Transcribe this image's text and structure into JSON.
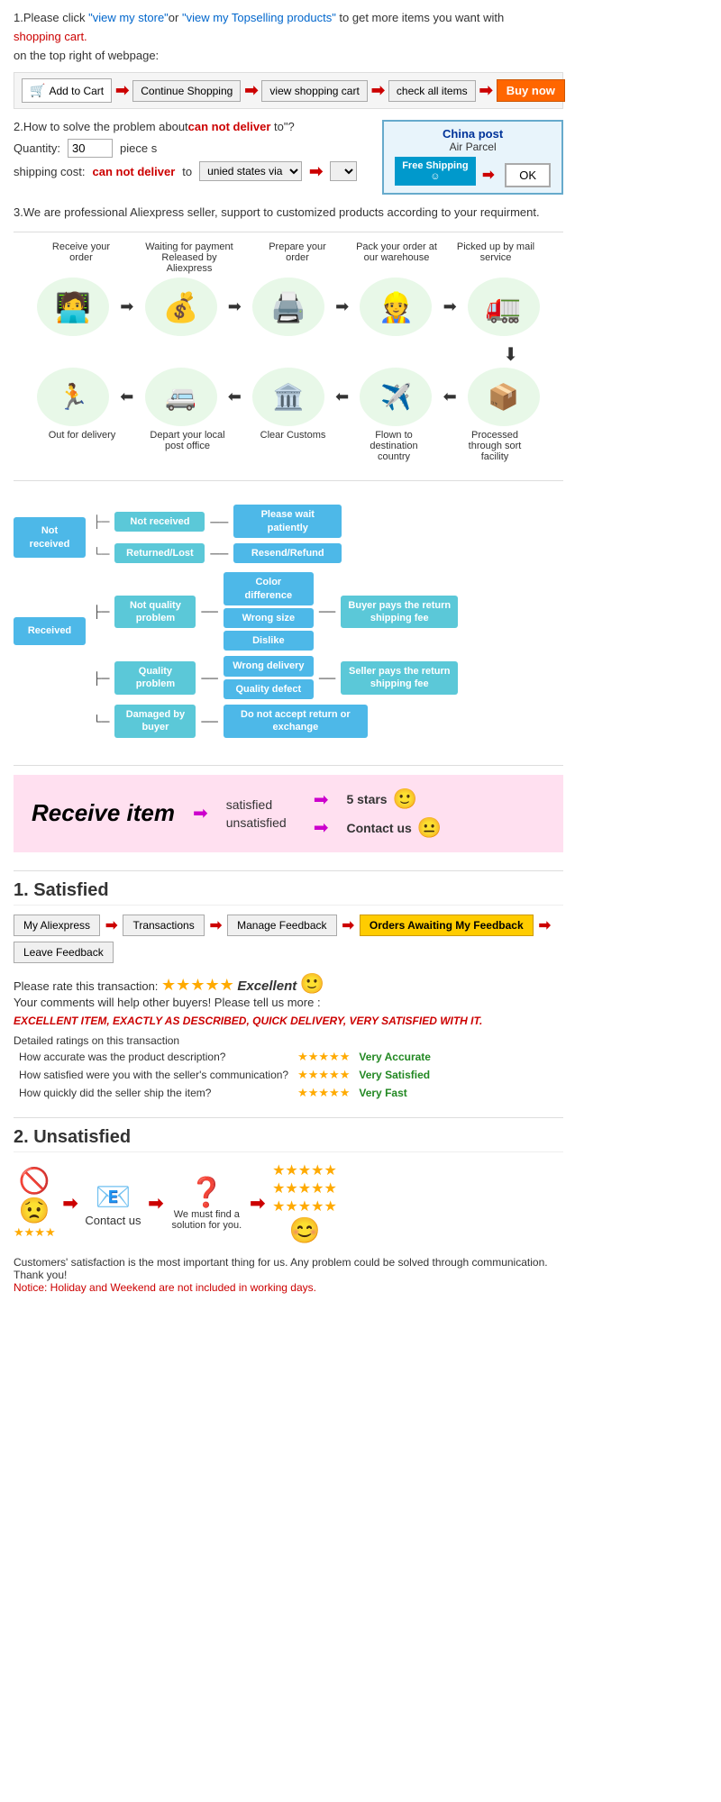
{
  "section1": {
    "text1": "1.Please click ",
    "link1": "\"view my store\"",
    "text2": "or ",
    "link2": "\"view my Topselling products\"",
    "text3": " to get more items you want with",
    "shopping_cart": "shopping cart.",
    "text4": "on the top right of webpage:",
    "buttons": {
      "add_cart": "Add to Cart",
      "continue": "Continue Shopping",
      "view_cart": "view shopping cart",
      "check_all": "check all items",
      "buy_now": "Buy now"
    }
  },
  "section2": {
    "title": "2.How to solve the problem about",
    "cant_deliver": "can not deliver",
    "title2": " to\"?",
    "qty_label": "Quantity:",
    "qty_value": "30",
    "pieces": "piece s",
    "shipping_label": "shipping cost:",
    "cant_deliver2": "can not deliver",
    "to_text": " to",
    "via_text": "unied states via",
    "china_post_title": "China post",
    "air_parcel": "Air Parcel",
    "free_shipping": "Free Shipping",
    "ok_btn": "OK"
  },
  "section3": {
    "text": "3.We are professional Aliexpress seller, support to customized products according to your requirment."
  },
  "flow": {
    "top_labels": [
      "Receive your order",
      "Waiting for payment Released by Aliexpress",
      "Prepare your order",
      "Pack your order at our warehouse",
      "Picked up by mail service"
    ],
    "top_icons": [
      "🧑‍💻",
      "💰",
      "🖨️",
      "👷",
      "🚛"
    ],
    "bot_labels": [
      "Out for delivery",
      "Depart your local post office",
      "Clear Customs",
      "Flown to destination country",
      "Processed through sort facility"
    ],
    "bot_icons": [
      "🏃",
      "🚐",
      "🏛️",
      "✈️",
      "📦"
    ]
  },
  "decision_tree": {
    "not_received": "Not received",
    "not_received_label": "Not received",
    "please_wait": "Please wait patiently",
    "returned_lost": "Returned/Lost",
    "resend_refund": "Resend/Refund",
    "received": "Received",
    "not_quality": "Not quality problem",
    "color_diff": "Color difference",
    "wrong_size": "Wrong size",
    "dislike": "Dislike",
    "buyer_pays": "Buyer pays the return shipping fee",
    "quality_problem": "Quality problem",
    "wrong_delivery": "Wrong delivery",
    "quality_defect": "Quality defect",
    "seller_pays": "Seller pays the return shipping fee",
    "damaged": "Damaged by buyer",
    "no_return": "Do not accept return or exchange"
  },
  "receive_item": {
    "title": "Receive item",
    "satisfied": "satisfied",
    "unsatisfied": "unsatisfied",
    "five_stars": "5 stars",
    "contact_us": "Contact us"
  },
  "satisfied": {
    "title": "1. Satisfied",
    "flow_btns": [
      "My Aliexpress",
      "Transactions",
      "Manage Feedback",
      "Orders Awaiting My Feedback",
      "Leave Feedback"
    ],
    "rate_text": "Please rate this transaction:",
    "excellent": "Excellent",
    "comment_help": "Your comments will help other buyers! Please tell us more :",
    "excellent_comment": "EXCELLENT ITEM, EXACTLY AS DESCRIBED, QUICK DELIVERY, VERY SATISFIED WITH IT.",
    "detailed_title": "Detailed ratings on this transaction",
    "rating1_label": "How accurate was the product description?",
    "rating1_value": "Very Accurate",
    "rating2_label": "How satisfied were you with the seller's communication?",
    "rating2_value": "Very Satisfied",
    "rating3_label": "How quickly did the seller ship the item?",
    "rating3_value": "Very Fast"
  },
  "unsatisfied": {
    "title": "2. Unsatisfied",
    "icons": [
      "🚫",
      "😟",
      "📧",
      "❓",
      "😊"
    ],
    "contact_us": "Contact us",
    "find_solution": "We must find a solution for you.",
    "notice1": "Customers' satisfaction is the most important thing for us. Any problem could be solved through communication. Thank you!",
    "notice2": "Notice: Holiday and Weekend are not included in working days."
  }
}
